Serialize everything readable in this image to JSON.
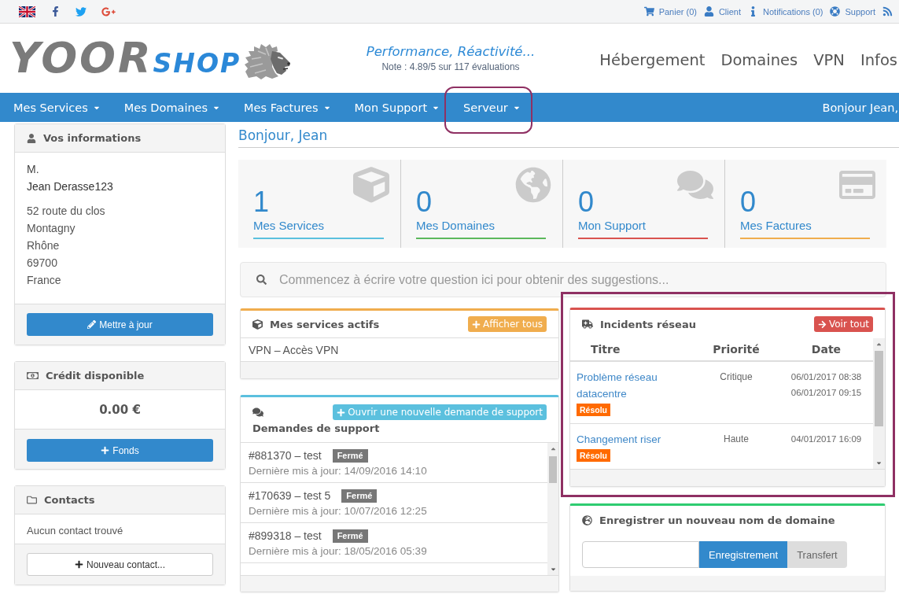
{
  "top_bar": {
    "links": [
      "Panier (0)",
      "Client",
      "Notifications (0)",
      "Support"
    ]
  },
  "header": {
    "logo": {
      "text": "YOOR",
      "accent": "SHOP"
    },
    "tagline": "Performance, Réactivité...",
    "rating": "Note : 4.89/5 sur 117 évaluations",
    "menu": [
      "Hébergement",
      "Domaines",
      "VPN",
      "Infos"
    ]
  },
  "nav": {
    "items": [
      {
        "label": "Mes Services",
        "highlighted": false
      },
      {
        "label": "Mes Domaines",
        "highlighted": false
      },
      {
        "label": "Mes Factures",
        "highlighted": false
      },
      {
        "label": "Mon Support",
        "highlighted": false
      },
      {
        "label": "Serveur",
        "highlighted": true
      }
    ],
    "greeting": "Bonjour Jean,"
  },
  "sidebar": {
    "profile": {
      "title": "Vos informations",
      "salutation": "M.",
      "name": "Jean Derasse123",
      "address": [
        "52 route du clos",
        "Montagny",
        "Rhône",
        "69700",
        "France"
      ],
      "button": "Mettre à jour"
    },
    "credit": {
      "title": "Crédit disponible",
      "amount": "0.00 €",
      "button": "Fonds"
    },
    "contacts": {
      "title": "Contacts",
      "empty": "Aucun contact trouvé",
      "button": "Nouveau contact..."
    }
  },
  "greeting": "Bonjour, Jean",
  "stats": [
    {
      "count": "1",
      "label": "Mes Services",
      "color": "#5bc0de"
    },
    {
      "count": "0",
      "label": "Mes Domaines",
      "color": "#5cb85c"
    },
    {
      "count": "0",
      "label": "Mon Support",
      "color": "#d9534f"
    },
    {
      "count": "0",
      "label": "Mes Factures",
      "color": "#f0ad4e"
    }
  ],
  "search": {
    "placeholder": "Commencez à écrire votre question ici pour obtenir des suggestions..."
  },
  "services": {
    "title": "Mes services actifs",
    "button": "Afficher tous",
    "items": [
      "VPN – Accès VPN"
    ]
  },
  "tickets": {
    "title": "Demandes de support",
    "button": "Ouvrir une nouvelle demande de support",
    "rows": [
      {
        "subject": "#881370 – test",
        "status": "Fermé",
        "updated": "Dernière mis à jour: 14/09/2016 14:10"
      },
      {
        "subject": "#170639 – test 5",
        "status": "Fermé",
        "updated": "Dernière mis à jour: 10/07/2016 12:25"
      },
      {
        "subject": "#899318 – test",
        "status": "Fermé",
        "updated": "Dernière mis à jour: 18/05/2016 05:39"
      }
    ]
  },
  "incidents": {
    "title": "Incidents réseau",
    "button": "Voir tout",
    "highlighted": true,
    "columns": [
      "Titre",
      "Priorité",
      "Date"
    ],
    "rows": [
      {
        "title": "Problème réseau datacentre",
        "status": "Résolu",
        "priority": "Critique",
        "dates": [
          "06/01/2017 08:38",
          "06/01/2017 09:15"
        ]
      },
      {
        "title": "Changement riser",
        "status": "Résolu",
        "priority": "Haute",
        "dates": [
          "04/01/2017 16:09"
        ]
      }
    ]
  },
  "domain": {
    "title": "Enregistrer un nouveau nom de domaine",
    "buttons": [
      {
        "label": "Enregistrement",
        "selected": true
      },
      {
        "label": "Transfert",
        "selected": false
      }
    ]
  }
}
